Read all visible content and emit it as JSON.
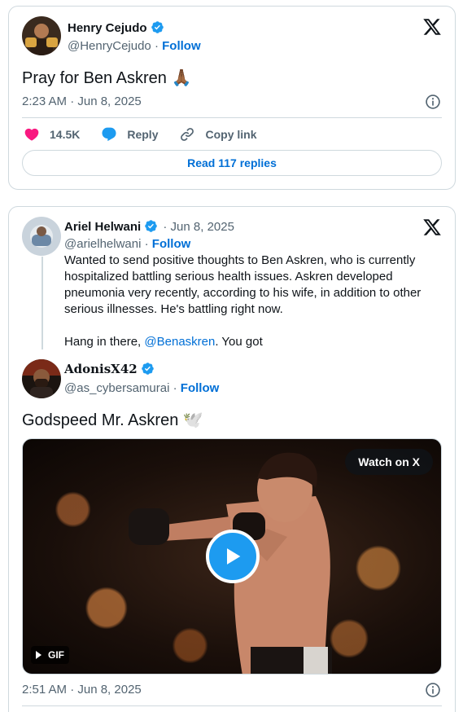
{
  "tweet1": {
    "author_name": "Henry Cejudo",
    "handle": "@HenryCejudo",
    "separator": "·",
    "follow_label": "Follow",
    "text": "Pray for Ben Askren",
    "emoji": "🙏🏾",
    "timestamp": "2:23 AM · Jun 8, 2025",
    "likes": "14.5K",
    "reply_label": "Reply",
    "copy_link_label": "Copy link",
    "read_replies_label": "Read 117 replies"
  },
  "tweet2": {
    "quoted": {
      "author_name": "Ariel Helwani",
      "date": "· Jun 8, 2025",
      "handle": "@arielhelwani",
      "separator": "·",
      "follow_label": "Follow",
      "text_line1": "Wanted to send positive thoughts to Ben Askren, who is currently hospitalized battling serious health issues. Askren developed pneumonia very recently, according to his wife, in addition to other serious illnesses. He's battling right now.",
      "text_prefix": "Hang in there, ",
      "mention": "@Benaskren",
      "text_suffix": ". You got"
    },
    "reply": {
      "author_name": "𝐀𝐝𝐨𝐧𝐢𝐬𝐗𝟒𝟐",
      "handle": "@as_cybersamurai",
      "separator": "·",
      "follow_label": "Follow",
      "text": "Godspeed Mr. Askren",
      "emoji": "🕊️",
      "watch_label": "Watch on X",
      "gif_label": "GIF",
      "timestamp": "2:51 AM · Jun 8, 2025"
    }
  },
  "colors": {
    "accent_blue": "#006fd6",
    "verified_blue": "#1d9bf0",
    "like_pink": "#f91880",
    "secondary_text": "#536471",
    "border": "#cfd9de"
  },
  "icons": [
    "verified-badge-icon",
    "x-logo-icon",
    "heart-icon",
    "reply-bubble-icon",
    "link-icon",
    "info-icon",
    "play-icon",
    "gif-play-icon"
  ]
}
